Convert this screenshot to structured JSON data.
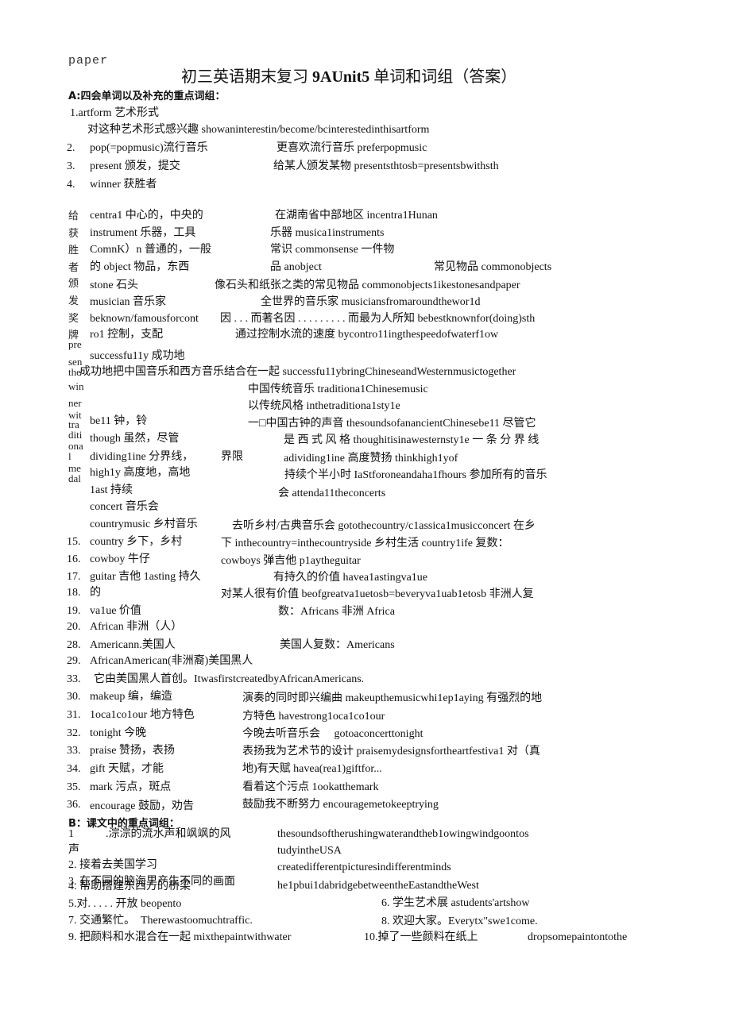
{
  "header": {
    "label": "paper",
    "title_a": "初三英语期末复习 ",
    "title_b": "9AUnit5",
    "title_c": " 单词和词组（答案）"
  },
  "section_a": "A:四会单词以及补充的重点词组：",
  "section_b": "B：课文中的重点词组：",
  "a": [
    "1.artform 艺术形式",
    "对这种艺术形式感兴趣 showaninterestin/become/bcinterestedinthisartform",
    "2.",
    "pop(=popmusic)流行音乐",
    "更喜欢流行音乐 preferpopmusic",
    "3.",
    "present 颁发，提交",
    "给某人颁发某物 presentsthtosb=presentsbwithsth",
    "4.",
    "winner 获胜者",
    "centra1 中心的，中央的",
    "在湖南省中部地区 incentra1Hunan",
    "instrument 乐器，工具",
    "乐器 musica1instruments",
    "ComnK）n 普通的，一般",
    "常识 commonsense 一件物",
    "的 object 物品，东西",
    "品 anobject",
    "常见物品 commonobjects",
    "stone 石头",
    "像石头和纸张之类的常见物品 commonobjects1ikestonesandpaper",
    "musician 音乐家",
    "全世界的音乐家 musiciansfromaroundthewor1d",
    "beknown/famousforcont",
    "因 . . . 而著名因 . . . . . . . . . 而最为人所知 bebestknownfor(doing)sth",
    "ro1 控制，支配",
    "通过控制水流的速度 bycontro11ingthespeedofwaterf1ow",
    "successfu11y 成功地",
    "成功地把中国音乐和西方音乐结合在一起 successfu11ybringChineseandWesternmusictogether",
    "中国传统音乐 traditiona1Chinesemusic",
    "以传统风格 inthetraditiona1sty1e",
    "be11 钟，铃",
    "一□中国古钟的声音 thesoundsofanancientChinesebe11 尽管它",
    "though 虽然，尽管",
    "是 西 式 风 格 thoughitisinawesternsty1e 一 条 分 界 线",
    "dividing1ine 分界线，",
    "界限",
    "adividing1ine 高度赞扬 thinkhigh1yof",
    "high1y 高度地，高地",
    "持续个半小时 IaStforoneandaha1fhours 参加所有的音乐",
    "1ast 持续",
    "会 attenda11theconcerts",
    "concert 音乐会",
    "countrymusic 乡村音乐",
    "去听乡村/古典音乐会 gotothecountry/c1assica1musicconcert 在乡",
    "15.",
    "country 乡下，乡村",
    "下 inthecountry=inthecountryside 乡村生活 country1ife 复数：",
    "16.",
    "cowboy 牛仔",
    "cowboys 弹吉他 p1aytheguitar",
    "17.",
    "guitar 吉他 1asting 持久",
    "有持久的价值 havea1astingva1ue",
    "18.",
    "的",
    "对某人很有价值 beofgreatva1uetosb=beveryva1uab1etosb 非洲人复",
    "19.",
    "va1ue 价值",
    "数：Africans 非洲 Africa",
    "20.",
    "African 非洲（人）",
    "28.",
    "Americann.美国人",
    "美国人复数：Americans",
    "29.",
    "AfricanAmerican(非洲裔)美国黑人",
    "33.",
    "它由美国黑人首创。ItwasfirstcreatedbyAfricanAmericans.",
    "30.",
    "makeup 编，编造",
    "演奏的同时即兴编曲 makeupthemusicwhi1ep1aying 有强烈的地",
    "31.",
    "1oca1co1our 地方特色",
    "方特色 havestrong1oca1co1our",
    "32.",
    "tonight 今晚",
    "今晚去听音乐会　 gotoaconcerttonight",
    "33.",
    "praise 赞扬，表扬",
    "表扬我为艺术节的设计 praisemydesignsfortheartfestiva1 对（真",
    "34.",
    "gift 天赋，才能",
    "地)有天赋 havea(rea1)giftfor...",
    "35.",
    "mark 污点，斑点",
    "看着这个污点 1ookatthemark",
    "36.",
    "encourage 鼓励，劝告",
    "鼓励我不断努力 encouragemetokeeptrying"
  ],
  "side": [
    "给",
    "获",
    "胜",
    "者",
    "颁",
    "发",
    "奖",
    "牌",
    "pre",
    "sen",
    "the",
    "win",
    "ner",
    "wit",
    "tra",
    "diti",
    "ona",
    "l",
    "me",
    "dal"
  ],
  "b": [
    "1",
    ".淙淙的流水声和飒飒的风",
    "thesoundsoftherushingwaterandtheb1owingwindgoontos",
    "声",
    "tudyintheUSA",
    "2. 接着去美国学习",
    "createdifferentpicturesindifferentminds",
    "3. 在不同的脑海里产生不同的画面",
    "4. 帮助搭建东西方的桥梁",
    "he1pbui1dabridgebetweentheEastandtheWest",
    "5.对. . . . . 开放 beopento",
    "6. 学生艺术展 astudents'artshow",
    "7. 交通繁忙。　Therewastoomuchtraffic.",
    "8. 欢迎大家。Everytx\"swe1come.",
    "9. 把颜料和水混合在一起 mixthepaintwithwater",
    "10.掉了一些颜料在纸上",
    "dropsomepaintontothe"
  ]
}
